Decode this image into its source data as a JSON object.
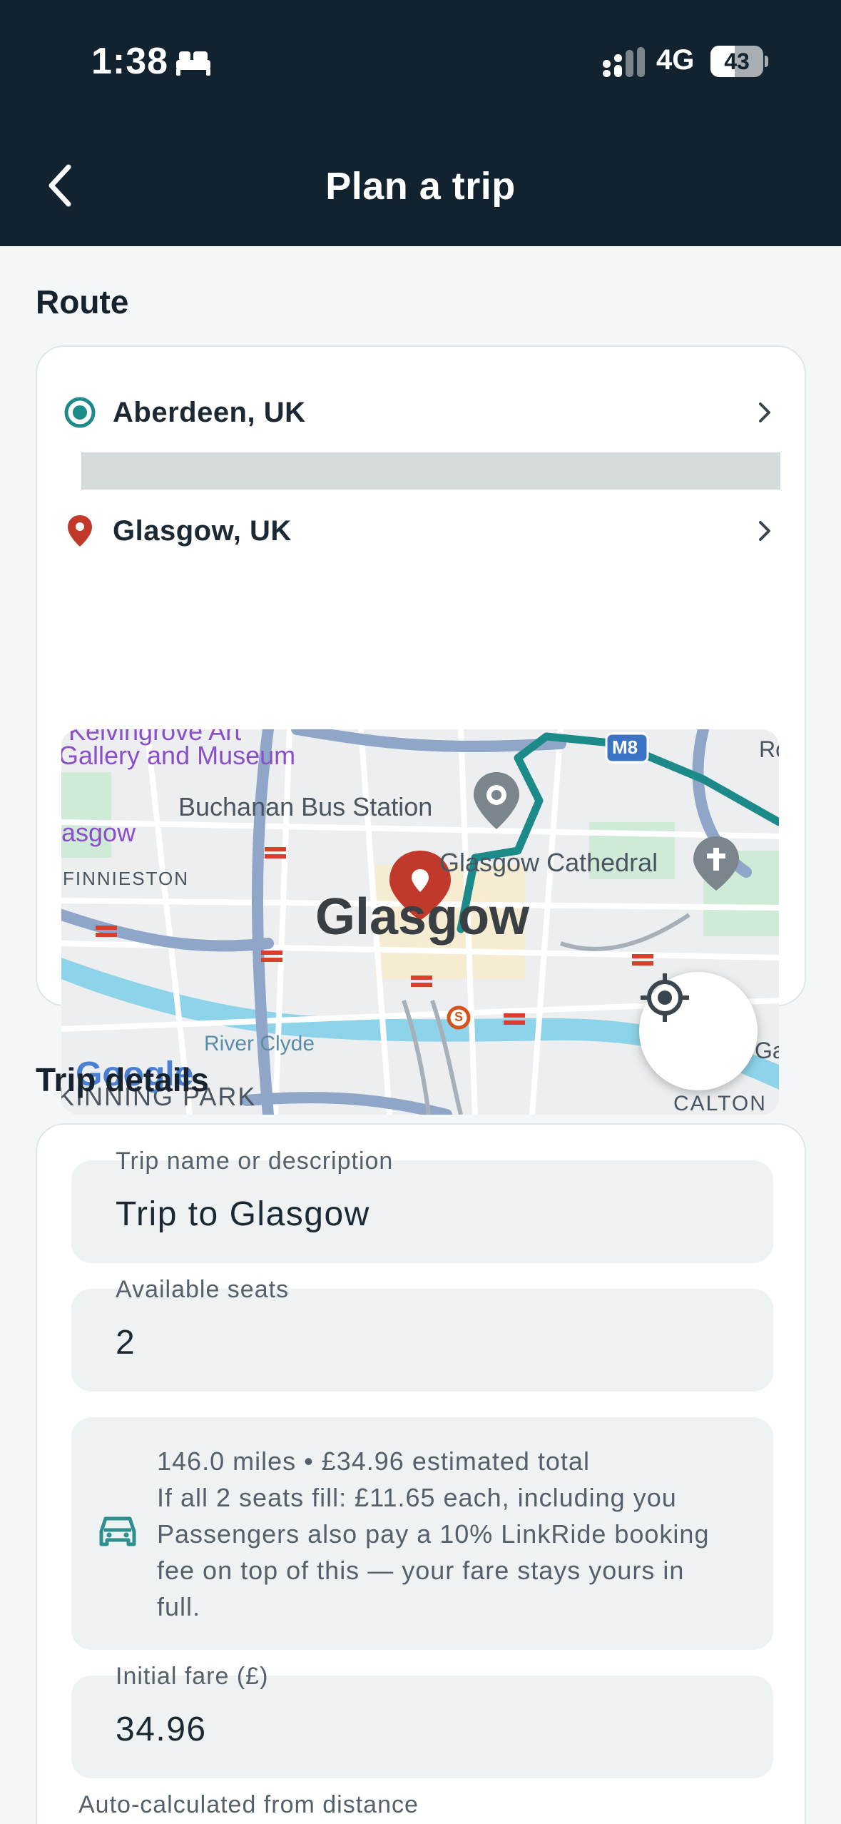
{
  "status_bar": {
    "time": "1:38",
    "network": "4G",
    "battery": "43"
  },
  "header": {
    "title": "Plan a trip"
  },
  "route": {
    "section_title": "Route",
    "origin": "Aberdeen, UK",
    "destination": "Glasgow, UK",
    "map": {
      "labels": {
        "gallery_1": "Kelvingrove Art",
        "gallery_2": "Gallery and Museum",
        "bus_station": "Buchanan Bus Station",
        "glasgow_small": "asgow",
        "finnieston": "FINNIESTON",
        "cathedral": "Glasgow Cathedral",
        "city": "Glasgow",
        "river": "River Clyde",
        "kinning": "KINNING PARK",
        "calton": "CALTON",
        "motorway": "M8",
        "edge_right_top": "Ro",
        "edge_right_mid": "Ga",
        "subway": "S"
      },
      "attribution": "Google"
    }
  },
  "trip": {
    "section_title": "Trip details",
    "name_label": "Trip name or description",
    "name_value": "Trip to Glasgow",
    "seats_label": "Available seats",
    "seats_value": "2",
    "info_lines": [
      "146.0 miles • £34.96 estimated total",
      "If all 2 seats fill: £11.65 each, including you",
      "Passengers also pay a 10% LinkRide booking",
      "fee on top of this — your fare stays yours in",
      "full."
    ],
    "fare_label": "Initial fare (£)",
    "fare_value": "34.96",
    "fare_helper": "Auto-calculated from distance"
  },
  "colors": {
    "header_bg": "#12222f",
    "accent_teal": "#1d8a8a",
    "pin_red": "#c0392b",
    "field_bg": "#eef2f2"
  }
}
